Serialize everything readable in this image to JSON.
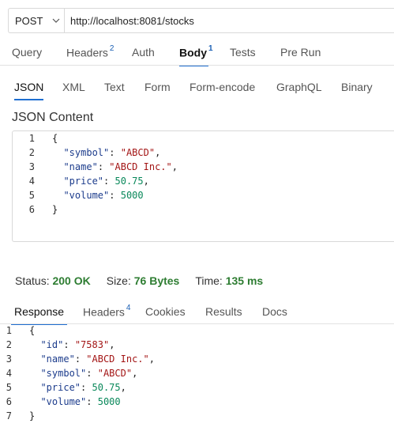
{
  "request": {
    "method": "POST",
    "url": "http://localhost:8081/stocks"
  },
  "request_tabs": [
    {
      "label": "Query",
      "badge": ""
    },
    {
      "label": "Headers",
      "badge": "2"
    },
    {
      "label": "Auth",
      "badge": ""
    },
    {
      "label": "Body",
      "badge": "1"
    },
    {
      "label": "Tests",
      "badge": ""
    },
    {
      "label": "Pre Run",
      "badge": ""
    }
  ],
  "body_tabs": [
    "JSON",
    "XML",
    "Text",
    "Form",
    "Form-encode",
    "GraphQL",
    "Binary"
  ],
  "json_content_title": "JSON Content",
  "request_body_lines": [
    {
      "n": "1",
      "t": "{"
    },
    {
      "n": "2",
      "t": "  \"symbol\": \"ABCD\","
    },
    {
      "n": "3",
      "t": "  \"name\": \"ABCD Inc.\","
    },
    {
      "n": "4",
      "t": "  \"price\": 50.75,"
    },
    {
      "n": "5",
      "t": "  \"volume\": 5000"
    },
    {
      "n": "6",
      "t": "}"
    }
  ],
  "status": {
    "status_label": "Status:",
    "status_value": "200 OK",
    "size_label": "Size:",
    "size_value": "76 Bytes",
    "time_label": "Time:",
    "time_value": "135 ms"
  },
  "response_tabs": [
    {
      "label": "Response",
      "badge": ""
    },
    {
      "label": "Headers",
      "badge": "4"
    },
    {
      "label": "Cookies",
      "badge": ""
    },
    {
      "label": "Results",
      "badge": ""
    },
    {
      "label": "Docs",
      "badge": ""
    }
  ],
  "response_body_lines": [
    {
      "n": "1",
      "t": "{"
    },
    {
      "n": "2",
      "t": "  \"id\": \"7583\","
    },
    {
      "n": "3",
      "t": "  \"name\": \"ABCD Inc.\","
    },
    {
      "n": "4",
      "t": "  \"symbol\": \"ABCD\","
    },
    {
      "n": "5",
      "t": "  \"price\": 50.75,"
    },
    {
      "n": "6",
      "t": "  \"volume\": 5000"
    },
    {
      "n": "7",
      "t": "}"
    }
  ],
  "colors": {
    "accent": "#1f6fd1",
    "success": "#2e7d32",
    "json_key": "#1c3c8c",
    "json_string": "#a31515",
    "json_number": "#09885a"
  }
}
